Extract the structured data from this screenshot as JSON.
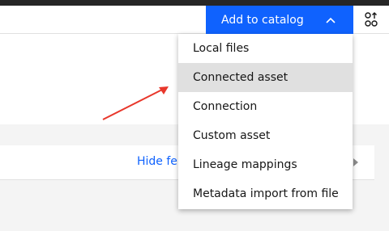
{
  "header": {
    "add_to_catalog_label": "Add to catalog",
    "chevron_icon": "chevron-up-icon",
    "settings_icon": "settings-adjust-icon"
  },
  "content": {
    "hide_link_text": "Hide fe"
  },
  "dropdown": {
    "items": [
      {
        "label": "Local files",
        "highlighted": false
      },
      {
        "label": "Connected asset",
        "highlighted": true
      },
      {
        "label": "Connection",
        "highlighted": false
      },
      {
        "label": "Custom asset",
        "highlighted": false
      },
      {
        "label": "Lineage mappings",
        "highlighted": false
      },
      {
        "label": "Metadata import from file",
        "highlighted": false
      }
    ]
  },
  "colors": {
    "primary_button": "#0f62fe",
    "link": "#0f62fe",
    "annotation_arrow": "#e8372b",
    "menu_hover": "#e0e0e0",
    "top_bar": "#262626"
  }
}
